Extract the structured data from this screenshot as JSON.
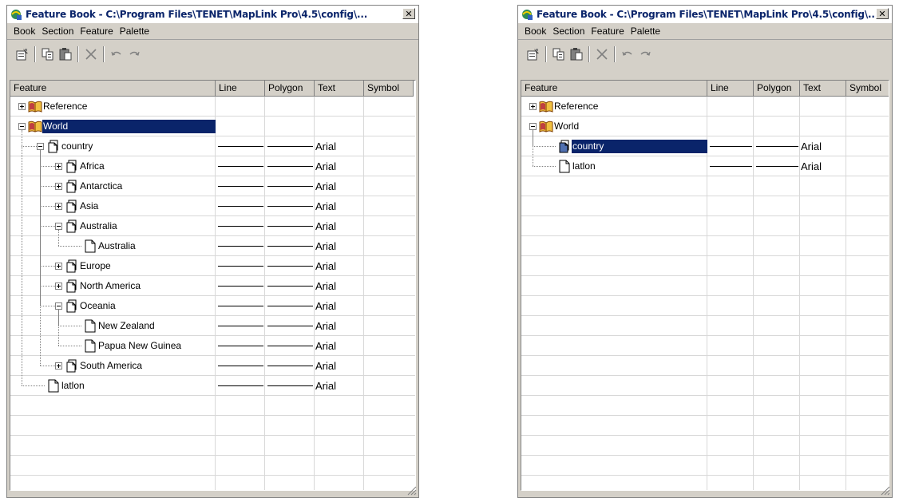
{
  "window": {
    "title": "Feature Book - C:\\Program Files\\TENET\\MapLink Pro\\4.5\\config\\...",
    "close_glyph": "✕"
  },
  "menu": [
    "Book",
    "Section",
    "Feature",
    "Palette"
  ],
  "toolbar": {
    "icons": [
      "properties-icon",
      "copy-icon",
      "paste-icon",
      "delete-icon",
      "undo-icon",
      "redo-icon"
    ]
  },
  "columns": [
    "Feature",
    "Line",
    "Polygon",
    "Text",
    "Symbol"
  ],
  "colors": {
    "selection": "#0a246a",
    "title_text": "#0a246a",
    "chrome": "#d4d0c8"
  },
  "left_panel": {
    "rows": [
      {
        "label": "Reference",
        "depth": 0,
        "icon": "book",
        "toggle": "plus",
        "styles": false
      },
      {
        "label": "World",
        "depth": 0,
        "icon": "book",
        "toggle": "minus",
        "styles": false,
        "selected": true
      },
      {
        "label": "country",
        "depth": 1,
        "icon": "folder",
        "toggle": "minus",
        "styles": true,
        "text": "Arial"
      },
      {
        "label": "Africa",
        "depth": 2,
        "icon": "folder",
        "toggle": "plus",
        "styles": true,
        "text": "Arial"
      },
      {
        "label": "Antarctica",
        "depth": 2,
        "icon": "folder",
        "toggle": "plus",
        "styles": true,
        "text": "Arial"
      },
      {
        "label": "Asia",
        "depth": 2,
        "icon": "folder",
        "toggle": "plus",
        "styles": true,
        "text": "Arial"
      },
      {
        "label": "Australia",
        "depth": 2,
        "icon": "folder",
        "toggle": "minus",
        "styles": true,
        "text": "Arial"
      },
      {
        "label": "Australia",
        "depth": 3,
        "icon": "page",
        "toggle": "none",
        "styles": true,
        "text": "Arial"
      },
      {
        "label": "Europe",
        "depth": 2,
        "icon": "folder",
        "toggle": "plus",
        "styles": true,
        "text": "Arial"
      },
      {
        "label": "North America",
        "depth": 2,
        "icon": "folder",
        "toggle": "plus",
        "styles": true,
        "text": "Arial"
      },
      {
        "label": "Oceania",
        "depth": 2,
        "icon": "folder",
        "toggle": "minus",
        "styles": true,
        "text": "Arial"
      },
      {
        "label": "New Zealand",
        "depth": 3,
        "icon": "page",
        "toggle": "none",
        "styles": true,
        "text": "Arial"
      },
      {
        "label": "Papua New Guinea",
        "depth": 3,
        "icon": "page",
        "toggle": "none",
        "styles": true,
        "text": "Arial"
      },
      {
        "label": "South America",
        "depth": 2,
        "icon": "folder",
        "toggle": "plus",
        "styles": true,
        "text": "Arial"
      },
      {
        "label": "latlon",
        "depth": 1,
        "icon": "page",
        "toggle": "none",
        "styles": true,
        "text": "Arial"
      }
    ]
  },
  "right_panel": {
    "rows": [
      {
        "label": "Reference",
        "depth": 0,
        "icon": "book",
        "toggle": "plus",
        "styles": false
      },
      {
        "label": "World",
        "depth": 0,
        "icon": "book",
        "toggle": "minus",
        "styles": false
      },
      {
        "label": "country",
        "depth": 1,
        "icon": "folder-filled",
        "toggle": "none",
        "styles": true,
        "text": "Arial",
        "selected": true
      },
      {
        "label": "latlon",
        "depth": 1,
        "icon": "page",
        "toggle": "none",
        "styles": true,
        "text": "Arial"
      }
    ]
  }
}
